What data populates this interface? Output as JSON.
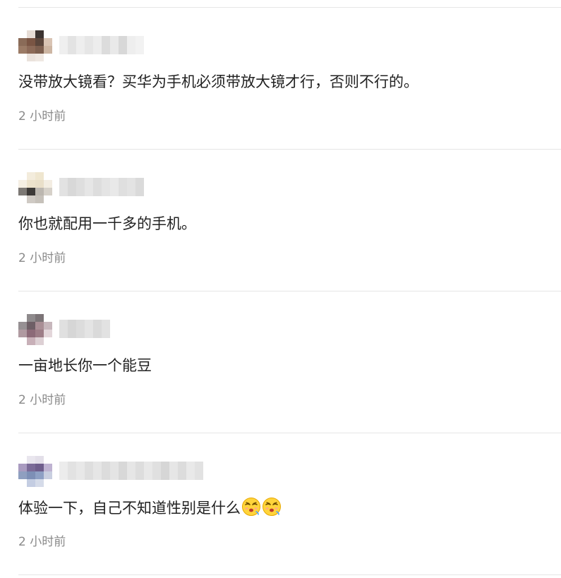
{
  "comments": [
    {
      "username_hidden": true,
      "avatar_colors": [
        "#ffffff",
        "#e7ddd6",
        "#3c3431",
        "#ffffff",
        "#8a6b58",
        "#7a5544",
        "#5b463c",
        "#d9c4b4",
        "#9b7b66",
        "#8c6a58",
        "#7d5f4f",
        "#cdb6a3",
        "#ffffff",
        "#eae2dc",
        "#efe8e2",
        "#ffffff"
      ],
      "name_colors": [
        "#efefef",
        "#e3e3e3",
        "#eeeeee",
        "#e6e6e6",
        "#ededed",
        "#dcdcdc",
        "#e9e9e9",
        "#d8d8d8",
        "#eeeeee",
        "#f2f2f2"
      ],
      "text": "没带放大镜看？买华为手机必须带放大镜才行，否则不行的。",
      "time": "2 小时前"
    },
    {
      "username_hidden": true,
      "avatar_colors": [
        "#ffffff",
        "#f3ecdc",
        "#efe6cf",
        "#ffffff",
        "#f5efe3",
        "#ece2cc",
        "#e9dfc9",
        "#f3ede2",
        "#7c7874",
        "#3d3a38",
        "#bcb7b0",
        "#d6d1c9",
        "#ffffff",
        "#cfcac4",
        "#c6c1ba",
        "#ffffff"
      ],
      "name_colors": [
        "#e2e2e2",
        "#d8d8d8",
        "#dedede",
        "#e6e6e6",
        "#dddddd",
        "#e4e4e4",
        "#e9e9e9",
        "#dfdfdf",
        "#e3e3e3",
        "#dadada"
      ],
      "text": "你也就配用一千多的手机。",
      "time": "2 小时前"
    },
    {
      "username_hidden": true,
      "avatar_colors": [
        "#ffffff",
        "#8e8a8c",
        "#7b7477",
        "#ffffff",
        "#969093",
        "#6e5f66",
        "#a98e95",
        "#c7b7bc",
        "#b09aa1",
        "#8c6a78",
        "#9d7d87",
        "#e3d6da",
        "#ffffff",
        "#c8b0b8",
        "#ddd0d4",
        "#ffffff"
      ],
      "name_colors": [
        "#e0e0e0",
        "#d6d6d6",
        "#dcdcdc",
        "#e4e4e4",
        "#dadada",
        "#e2e2e2"
      ],
      "text": "一亩地长你一个能豆",
      "time": "2 小时前"
    },
    {
      "username_hidden": true,
      "avatar_colors": [
        "#ffffff",
        "#e9e6ee",
        "#e3dfe9",
        "#ffffff",
        "#a99bc0",
        "#7b6b98",
        "#6f5e8c",
        "#bfb3d2",
        "#8f9fc0",
        "#7d8fb6",
        "#8ea0c4",
        "#c9cfe0",
        "#ffffff",
        "#c4cde2",
        "#d5dbe9",
        "#ffffff"
      ],
      "name_colors": [
        "#ececec",
        "#e2e2e2",
        "#e8e8e8",
        "#dedede",
        "#e6e6e6",
        "#dcdcdc",
        "#e4e4e4",
        "#d8d8d8",
        "#e6e6e6",
        "#dddddd",
        "#e8e8e8",
        "#e0e0e0",
        "#d6d6d6",
        "#e6e6e6",
        "#dcdcdc",
        "#e9e9e9",
        "#e2e2e2"
      ],
      "text": "体验一下，自己不知道性别是什么",
      "emoji_count": 2,
      "emoji_name": "pouting-face-emoji",
      "time": "2 小时前"
    }
  ]
}
